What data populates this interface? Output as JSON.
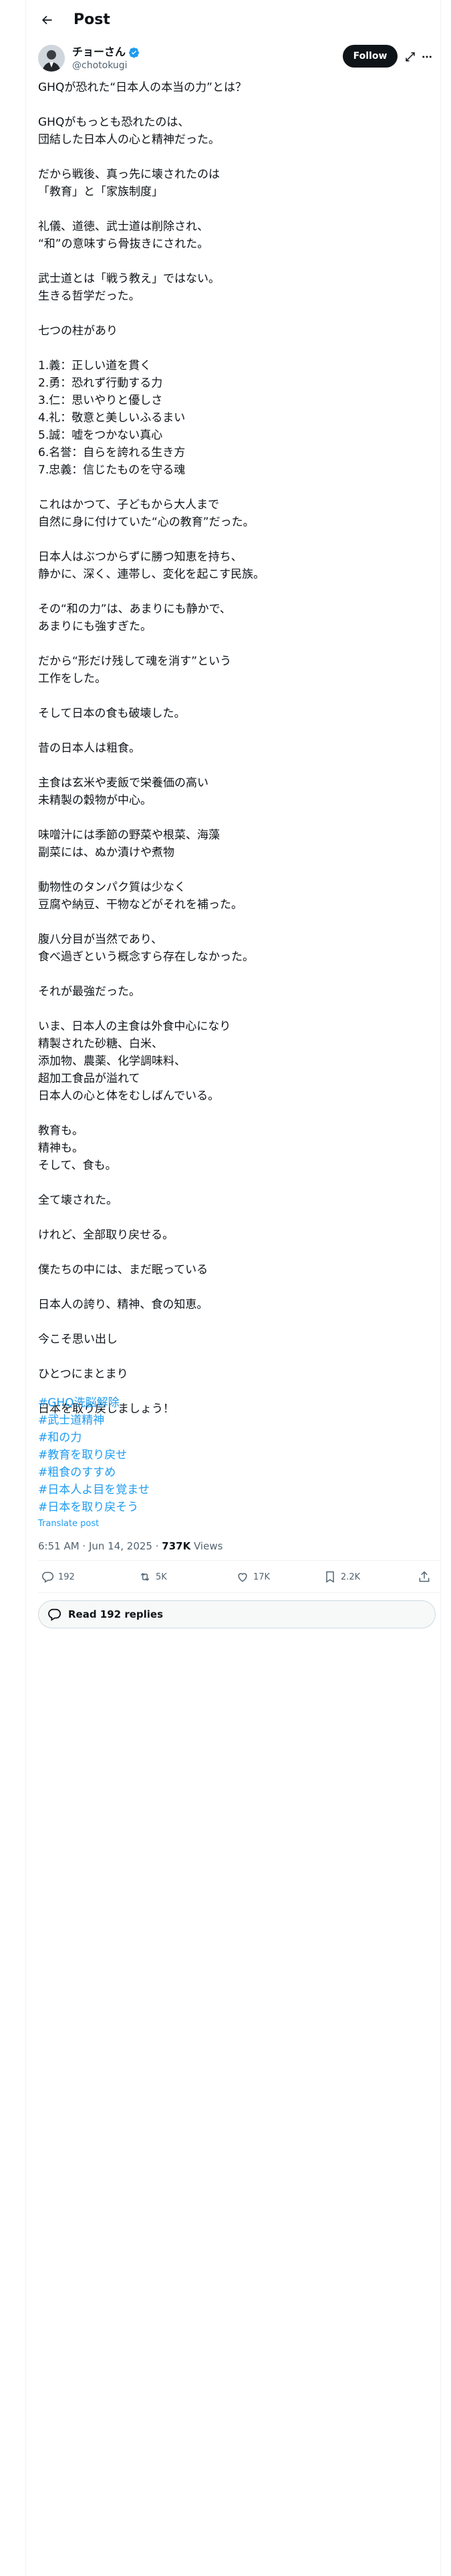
{
  "header": {
    "title": "Post"
  },
  "author": {
    "name": "チョーさん",
    "handle": "@chotokugi"
  },
  "follow_label": "Follow",
  "post": {
    "text": "GHQが恐れた“日本人の本当の力”とは？\n\nGHQがもっとも恐れたのは、\n団結した日本人の心と精神だった。\n\nだから戦後、真っ先に壊されたのは\n「教育」と「家族制度」\n\n礼儀、道徳、武士道は削除され、\n“和”の意味すら骨抜きにされた。\n\n武士道とは「戦う教え」ではない。\n生きる哲学だった。\n\n七つの柱があり\n\n1.義：正しい道を貫く\n2.勇：恐れず行動する力\n3.仁：思いやりと優しさ\n4.礼：敬意と美しいふるまい\n5.誠：嘘をつかない真心\n6.名誉：自らを誇れる生き方\n7.忠義：信じたものを守る魂\n\nこれはかつて、子どもから大人まで\n自然に身に付けていた“心の教育”だった。\n\n日本人はぶつからずに勝つ知恵を持ち、\n静かに、深く、連帯し、変化を起こす民族。\n\nその“和の力”は、あまりにも静かで、\nあまりにも強すぎた。\n\nだから“形だけ残して魂を消す”という\n工作をした。\n\nそして日本の食も破壊した。\n\n昔の日本人は粗食。\n\n主食は玄米や麦飯で栄養価の高い\n未精製の穀物が中心。\n\n味噌汁には季節の野菜や根菜、海藻\n副菜には、ぬか漬けや煮物\n\n動物性のタンパク質は少なく\n豆腐や納豆、干物などがそれを補った。\n\n腹八分目が当然であり、\n食べ過ぎという概念すら存在しなかった。\n\nそれが最強だった。\n\nいま、日本人の主食は外食中心になり\n精製された砂糖、白米、\n添加物、農薬、化学調味料、\n超加工食品が溢れて\n日本人の心と体をむしばんでいる。\n\n教育も。\n精神も。\nそして、食も。\n\n全て壊された。\n\nけれど、全部取り戻せる。\n\n僕たちの中には、まだ眠っている\n\n日本人の誇り、精神、食の知恵。\n\n今こそ思い出し\n\nひとつにまとまり\n\n日本を取り戻しましょう！"
  },
  "hashtags": [
    "#GHQ洗脳解除",
    "#武士道精神",
    "#和の力",
    "#教育を取り戻せ",
    "#粗食のすすめ",
    "#日本人よ目を覚ませ",
    "#日本を取り戻そう"
  ],
  "translate_label": "Translate post",
  "meta": {
    "timestamp": "6:51 AM · Jun 14, 2025 · ",
    "views_count": "737K",
    "views_label": " Views"
  },
  "actions": {
    "replies": "192",
    "reposts": "5K",
    "likes": "17K",
    "bookmarks": "2.2K"
  },
  "read_replies_label": "Read 192 replies",
  "colors": {
    "accent": "#1d9bf0",
    "text": "#0f1419",
    "muted": "#536471"
  }
}
